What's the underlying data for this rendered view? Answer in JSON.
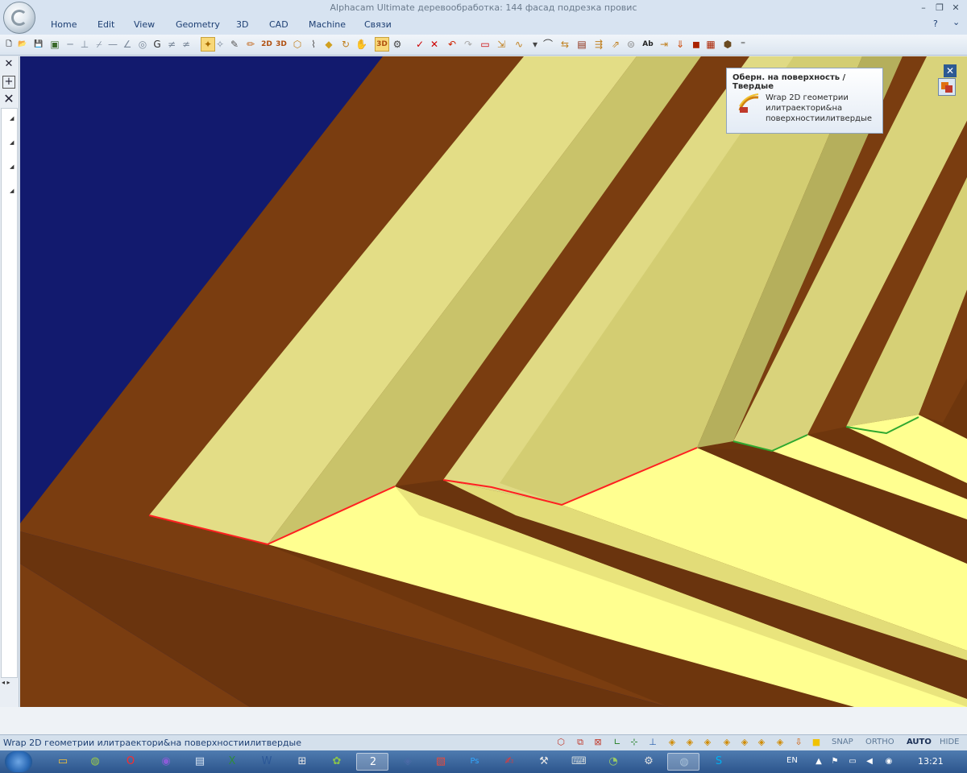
{
  "window": {
    "title": "Alphacam Ultimate деревообработка: 144 фасад подрезка провис",
    "minimize": "–",
    "restore": "❐",
    "close": "✕"
  },
  "menu": {
    "items": [
      "Home",
      "Edit",
      "View",
      "Geometry",
      "3D",
      "CAD",
      "Machine",
      "Связи"
    ],
    "help": "?",
    "collapse": "⌄"
  },
  "toolbar": {
    "icons": [
      {
        "name": "new-file-icon",
        "glyph": "🗋",
        "color": "#333333"
      },
      {
        "name": "open-folder-icon",
        "glyph": "📂",
        "color": "#c88a10"
      },
      {
        "name": "save-icon",
        "glyph": "💾",
        "color": "#333333"
      },
      {
        "name": "toolbar-config-icon",
        "glyph": "▣",
        "color": "#3a6a2a"
      },
      {
        "name": "line-horizontal-icon",
        "glyph": "─",
        "color": "#7a8899"
      },
      {
        "name": "perpendicular-icon",
        "glyph": "⊥",
        "color": "#7a8899"
      },
      {
        "name": "tangent-icon",
        "glyph": "⌿",
        "color": "#7a8899"
      },
      {
        "name": "line-dash-icon",
        "glyph": "—",
        "color": "#7a8899"
      },
      {
        "name": "angle-line-icon",
        "glyph": "∠",
        "color": "#7a8899"
      },
      {
        "name": "circle-icon",
        "glyph": "◎",
        "color": "#7a8899"
      },
      {
        "name": "arc-icon",
        "glyph": "G",
        "color": "#333333"
      },
      {
        "name": "parallel-icon",
        "glyph": "≠",
        "color": "#7a8899"
      },
      {
        "name": "not-parallel-icon",
        "glyph": "≄",
        "color": "#7a8899"
      },
      {
        "name": "wrap-2d-icon",
        "glyph": "✦",
        "color": "#a86b00"
      },
      {
        "name": "snap-point-icon",
        "glyph": "✧",
        "color": "#7a8899"
      },
      {
        "name": "pen-icon",
        "glyph": "✎",
        "color": "#555555"
      },
      {
        "name": "pencil-edit-icon",
        "glyph": "✏",
        "color": "#c06010"
      },
      {
        "name": "view-2d-icon",
        "glyph": "2D",
        "color": "#b05010"
      },
      {
        "name": "view-3d-icon",
        "glyph": "3D",
        "color": "#b05010"
      },
      {
        "name": "surface-icon",
        "glyph": "⬡",
        "color": "#c08020"
      },
      {
        "name": "sweep-icon",
        "glyph": "⌇",
        "color": "#555555"
      },
      {
        "name": "project-icon",
        "glyph": "◆",
        "color": "#d0a020"
      },
      {
        "name": "rotate-icon",
        "glyph": "↻",
        "color": "#c08020"
      },
      {
        "name": "hand-icon",
        "glyph": "✋",
        "color": "#888888"
      },
      {
        "name": "view-3d-active-icon",
        "glyph": "3D",
        "color": "#b05010"
      },
      {
        "name": "settings-icon",
        "glyph": "⚙",
        "color": "#444444"
      },
      {
        "name": "check-icon",
        "glyph": "✓",
        "color": "#cc0000"
      },
      {
        "name": "cross-icon",
        "glyph": "✕",
        "color": "#cc0000"
      },
      {
        "name": "undo-icon",
        "glyph": "↶",
        "color": "#cc2200"
      },
      {
        "name": "redo-icon",
        "glyph": "↷",
        "color": "#aaaaaa"
      },
      {
        "name": "rectangle-icon",
        "glyph": "▭",
        "color": "#cc0000"
      },
      {
        "name": "scale-icon",
        "glyph": "⇲",
        "color": "#c08020"
      },
      {
        "name": "curve-icon",
        "glyph": "∿",
        "color": "#c08020"
      },
      {
        "name": "dropdown-arrow-icon",
        "glyph": "▾",
        "color": "#444444"
      },
      {
        "name": "polyline-icon",
        "glyph": "⌒",
        "color": "#333333"
      },
      {
        "name": "measure-icon",
        "glyph": "⇆",
        "color": "#c08020"
      },
      {
        "name": "layer-icon",
        "glyph": "▤",
        "color": "#8b2a10"
      },
      {
        "name": "wrap-surface-icon",
        "glyph": "⇶",
        "color": "#c08020"
      },
      {
        "name": "extrude-icon",
        "glyph": "⇗",
        "color": "#c08020"
      },
      {
        "name": "offset-icon",
        "glyph": "⊜",
        "color": "#888888"
      },
      {
        "name": "text-icon",
        "glyph": "Ab",
        "color": "#222222"
      },
      {
        "name": "dimension-icon",
        "glyph": "⇥",
        "color": "#c08020"
      },
      {
        "name": "drill-icon",
        "glyph": "⇓",
        "color": "#cc4400"
      },
      {
        "name": "tool-icon",
        "glyph": "◼",
        "color": "#aa2200"
      },
      {
        "name": "machine-icon",
        "glyph": "▦",
        "color": "#aa2200"
      },
      {
        "name": "macro-icon",
        "glyph": "⬢",
        "color": "#6a4a20"
      },
      {
        "name": "overflow-icon",
        "glyph": "⁼",
        "color": "#555555"
      }
    ]
  },
  "left_panel": {
    "close": "✕",
    "add": "+",
    "remove": "✕",
    "pins": [
      "◢",
      "◢",
      "◢",
      "◢"
    ],
    "scroll": "◂ ▸"
  },
  "viewport": {
    "colors": {
      "background": "#121a6e",
      "wood": "#7a3d10",
      "wood_dark": "#5e2d0a",
      "panel_light": "#ffff90",
      "rib_light": "#e3dd86",
      "rib_mid": "#d2cc73",
      "rib_dark": "#b9b35f",
      "rib_shadow": "#9f9a50",
      "edge_red": "#ff2020",
      "edge_green": "#2fa82f"
    }
  },
  "tooltip": {
    "title": "Оберн. на поверхность / Твердые",
    "description": "Wrap 2D геометрии илитраектори&на поверхностиилитвердые",
    "icon": "wrap-2d-icon"
  },
  "panel_controls": {
    "close": "✕"
  },
  "status": {
    "text": "Wrap 2D геометрии илитраектори&на поверхностиилитвердые",
    "icons": [
      {
        "name": "iso-view-icon",
        "glyph": "⬡",
        "color": "#c0392b"
      },
      {
        "name": "front-view-icon",
        "glyph": "⧉",
        "color": "#c0392b"
      },
      {
        "name": "plan-view-icon",
        "glyph": "⊠",
        "color": "#c0392b"
      },
      {
        "name": "axis-icon",
        "glyph": "∟",
        "color": "#1a7a1a"
      },
      {
        "name": "ucs-icon",
        "glyph": "⊹",
        "color": "#1a7a1a"
      },
      {
        "name": "ucs-origin-icon",
        "glyph": "⊥",
        "color": "#1a55a8"
      },
      {
        "name": "cube-1-icon",
        "glyph": "◈",
        "color": "#d08a00"
      },
      {
        "name": "cube-2-icon",
        "glyph": "◈",
        "color": "#d08a00"
      },
      {
        "name": "cube-3-icon",
        "glyph": "◈",
        "color": "#d08a00"
      },
      {
        "name": "cube-4-icon",
        "glyph": "◈",
        "color": "#d08a00"
      },
      {
        "name": "cube-5-icon",
        "glyph": "◈",
        "color": "#d08a00"
      },
      {
        "name": "cube-6-icon",
        "glyph": "◈",
        "color": "#d08a00"
      },
      {
        "name": "cube-7-icon",
        "glyph": "◈",
        "color": "#d08a00"
      },
      {
        "name": "workplane-icon",
        "glyph": "⇩",
        "color": "#d05a00"
      },
      {
        "name": "layer-square-icon",
        "glyph": "■",
        "color": "#f0c200"
      }
    ],
    "modes": [
      "SNAP",
      "ORTHO",
      "AUTO",
      "HIDE"
    ]
  },
  "taskbar": {
    "apps": [
      {
        "name": "start-button"
      },
      {
        "name": "explorer-task",
        "glyph": "▭",
        "color": "#f2c13a"
      },
      {
        "name": "alphacam-task-small",
        "glyph": "◍",
        "color": "#9bc94a"
      },
      {
        "name": "opera-task",
        "glyph": "O",
        "color": "#ff2a2a"
      },
      {
        "name": "viber-task",
        "glyph": "◉",
        "color": "#8a5cd6"
      },
      {
        "name": "notepad-task",
        "glyph": "▤",
        "color": "#d9e6f5"
      },
      {
        "name": "excel-task",
        "glyph": "X",
        "color": "#2e8b3b"
      },
      {
        "name": "word-task",
        "glyph": "W",
        "color": "#2b5797"
      },
      {
        "name": "network-task",
        "glyph": "⊞",
        "color": "#e6e6e6"
      },
      {
        "name": "paint-task",
        "glyph": "✿",
        "color": "#8bc34a"
      },
      {
        "name": "number2-task",
        "glyph": "2",
        "color": "#ffffff"
      },
      {
        "name": "media-task",
        "glyph": "◈",
        "color": "#4a6aa6"
      },
      {
        "name": "gallery-task",
        "glyph": "▧",
        "color": "#e94b3c"
      },
      {
        "name": "photoshop-task",
        "glyph": "Ps",
        "color": "#31a8ff"
      },
      {
        "name": "pdf-task",
        "glyph": "✍",
        "color": "#e53935"
      },
      {
        "name": "tool-task",
        "glyph": "⚒",
        "color": "#e6e6e6"
      },
      {
        "name": "keyboard-task",
        "glyph": "⌨",
        "color": "#cfd8dc"
      },
      {
        "name": "spin-task",
        "glyph": "◔",
        "color": "#9ccc65"
      },
      {
        "name": "cnc-task",
        "glyph": "⚙",
        "color": "#e0e0e0"
      },
      {
        "name": "alphacam-task",
        "glyph": "◍",
        "color": "#a8c0d8"
      },
      {
        "name": "skype-task",
        "glyph": "S",
        "color": "#00aff0"
      }
    ],
    "language": "EN",
    "tray": [
      {
        "name": "tray-expand-icon",
        "glyph": "▲"
      },
      {
        "name": "tray-flag-icon",
        "glyph": "⚑"
      },
      {
        "name": "tray-display-icon",
        "glyph": "▭"
      },
      {
        "name": "tray-volume-icon",
        "glyph": "◀"
      },
      {
        "name": "tray-network-icon",
        "glyph": "◉"
      }
    ],
    "clock": "13:21"
  }
}
